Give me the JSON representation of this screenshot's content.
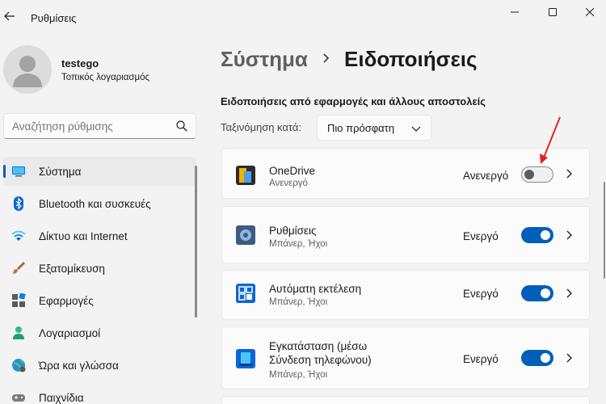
{
  "window": {
    "app_title": "Ρυθμίσεις"
  },
  "user": {
    "name": "testego",
    "account_type": "Τοπικός λογαριασμός"
  },
  "search": {
    "placeholder": "Αναζήτηση ρύθμισης"
  },
  "sidebar": {
    "items": [
      {
        "label": "Σύστημα",
        "icon": "system-icon",
        "active": true
      },
      {
        "label": "Bluetooth και συσκευές",
        "icon": "bluetooth-icon"
      },
      {
        "label": "Δίκτυο και Internet",
        "icon": "wifi-icon"
      },
      {
        "label": "Εξατομίκευση",
        "icon": "brush-icon"
      },
      {
        "label": "Εφαρμογές",
        "icon": "apps-icon"
      },
      {
        "label": "Λογαριασμοί",
        "icon": "account-icon"
      },
      {
        "label": "Ώρα και γλώσσα",
        "icon": "globe-icon"
      },
      {
        "label": "Παιχνίδια",
        "icon": "gamepad-icon"
      }
    ]
  },
  "breadcrumb": {
    "parent": "Σύστημα",
    "separator_icon": "chevron-right-icon",
    "current": "Ειδοποιήσεις"
  },
  "notifications": {
    "section_title": "Ειδοποιήσεις από εφαρμογές και άλλους αποστολείς",
    "sort_label": "Ταξινόμηση κατά:",
    "sort_value": "Πιο πρόσφατη",
    "apps": [
      {
        "name": "OneDrive",
        "subtitle": "Ανενεργό",
        "state_label": "Ανενεργό",
        "on": false,
        "icon": "onedrive-icon"
      },
      {
        "name": "Ρυθμίσεις",
        "subtitle": "Μπάνερ, Ήχοι",
        "state_label": "Ενεργό",
        "on": true,
        "icon": "settings-gear-icon"
      },
      {
        "name": "Αυτόματη εκτέλεση",
        "subtitle": "Μπάνερ, Ήχοι",
        "state_label": "Ενεργό",
        "on": true,
        "icon": "autoplay-icon"
      },
      {
        "name": "Εγκατάσταση (μέσω",
        "name_line2": "Σύνδεση τηλεφώνου)",
        "subtitle": "Μπάνερ, Ήχοι",
        "state_label": "Ενεργό",
        "on": true,
        "icon": "phone-link-icon"
      }
    ]
  },
  "colors": {
    "accent": "#005fb8",
    "annotation": "#e8211a"
  }
}
